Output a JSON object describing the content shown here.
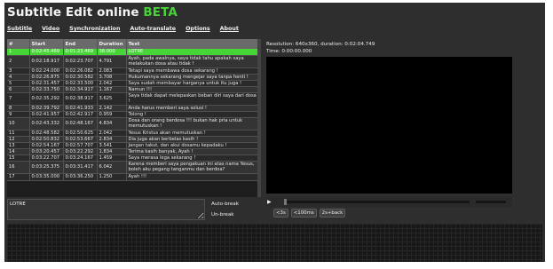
{
  "app": {
    "title": "Subtitle Edit online",
    "beta": "BETA"
  },
  "menu": [
    "Subtitle",
    "Video",
    "Synchronization",
    "Auto-translate",
    "Options",
    "About"
  ],
  "grid": {
    "columns": [
      "#",
      "Start",
      "End",
      "Duration",
      "Text"
    ],
    "rows": [
      {
        "no": "1",
        "start": "0:02:45.469",
        "end": "0:01:23.469",
        "dur": "38.000",
        "text": "LOTRE"
      },
      {
        "no": "2",
        "start": "0:02:18.917",
        "end": "0:02:23.707",
        "dur": "4.791",
        "text": "Ayah, pada awalnya, saya tidak tahu apakah saya melakukan dosa atau tidak !"
      },
      {
        "no": "3",
        "start": "0:02:24.000",
        "end": "0:02:26.082",
        "dur": "2.083",
        "text": "Tetapi saya membawa dosa sekarang !"
      },
      {
        "no": "4",
        "start": "0:02:26.875",
        "end": "0:02:30.582",
        "dur": "3.708",
        "text": "Hukumannya sekarang mengejar saya tanpa henti !"
      },
      {
        "no": "5",
        "start": "0:02:31.457",
        "end": "0:02:33.500",
        "dur": "2.042",
        "text": "Saya sudah membayar harganya untuk itu juga !"
      },
      {
        "no": "6",
        "start": "0:02:33.750",
        "end": "0:02:34.917",
        "dur": "1.167",
        "text": "Namun !!!"
      },
      {
        "no": "7",
        "start": "0:02:35.292",
        "end": "0:02:38.917",
        "dur": "3.625",
        "text": "Saya tidak dapat melepaskan beban diri saya dari dosa !"
      },
      {
        "no": "8",
        "start": "0:02:39.792",
        "end": "0:02:41.933",
        "dur": "2.142",
        "text": "Anda harus memberi saya solusi !"
      },
      {
        "no": "9",
        "start": "0:02:41.957",
        "end": "0:02:42.917",
        "dur": "0.959",
        "text": "Tolong !"
      },
      {
        "no": "10",
        "start": "0:02:43.332",
        "end": "0:02:48.167",
        "dur": "4.834",
        "text": "Dosa dan orang berdosa !!! bukan hak pria untuk memutuskan !"
      },
      {
        "no": "11",
        "start": "0:02:48.582",
        "end": "0:02:50.625",
        "dur": "2.042",
        "text": "Yesus Kristus akan memutuskan !"
      },
      {
        "no": "12",
        "start": "0:02:50.832",
        "end": "0:02:53.667",
        "dur": "2.834",
        "text": "Dia juga akan berbelas kasih !"
      },
      {
        "no": "13",
        "start": "0:02:54.167",
        "end": "0:02:57.707",
        "dur": "3.541",
        "text": "Jangan takut, dan akui dosamu kepadaku !"
      },
      {
        "no": "14",
        "start": "0:03:20.457",
        "end": "0:03:22.292",
        "dur": "1.834",
        "text": "Terima kasih banyak, Ayah !"
      },
      {
        "no": "15",
        "start": "0:03:22.707",
        "end": "0:03:24.167",
        "dur": "1.459",
        "text": "Saya merasa lega sekarang !"
      },
      {
        "no": "16",
        "start": "0:03:25.375",
        "end": "0:03:31.417",
        "dur": "6.042",
        "text": "Karena memberi saya pengakuan ini atas nama Yesus, boleh aku pegang tanganmu dan berdoa?"
      },
      {
        "no": "17",
        "start": "0:03:35.000",
        "end": "0:03:36.250",
        "dur": "1.250",
        "text": "Ayah !!!"
      }
    ]
  },
  "editor": {
    "value": "LOTRE"
  },
  "buttons": {
    "auto_break": "Auto-break",
    "un_break": "Un-break"
  },
  "info": {
    "resolution": "Resolution: 640x360, duration: 0:02:04.749",
    "time": "Time: 0:00:00.000"
  },
  "player": {
    "progress": 0.0,
    "volume": 0.0
  },
  "seek": [
    "<3s",
    "<100ms",
    "2s+back"
  ],
  "colors": {
    "accent": "#46d436",
    "background": "#2e2e2e",
    "video": "#000000"
  }
}
